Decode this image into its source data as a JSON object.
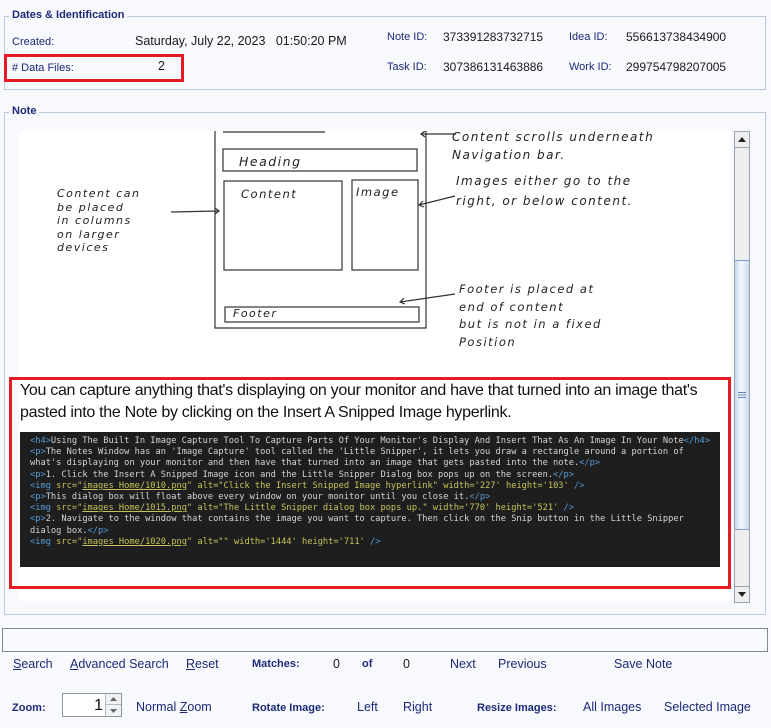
{
  "dates_section": {
    "legend": "Dates & Identification",
    "created_label": "Created:",
    "created_value": "Saturday, July 22, 2023   01:50:20 PM",
    "data_files_label": "# Data Files:",
    "data_files_value": "2",
    "note_id_label": "Note ID:",
    "note_id_value": "373391283732715",
    "idea_id_label": "Idea ID:",
    "idea_id_value": "556613738434900",
    "task_id_label": "Task ID:",
    "task_id_value": "307386131463886",
    "work_id_label": "Work ID:",
    "work_id_value": "299754798207005"
  },
  "note_section": {
    "legend": "Note",
    "sketch": {
      "box_heading": "Heading",
      "box_content": "Content",
      "box_image": "Image",
      "box_footer": "Footer",
      "annot_left": [
        "Content can",
        "be placed",
        "in columns",
        "on larger",
        "devices"
      ],
      "annot_top": [
        "Content scrolls underneath",
        "Navigation bar."
      ],
      "annot_image": [
        "Images either go to the",
        "right, or below content."
      ],
      "annot_footer": [
        "Footer is placed at",
        "end of content",
        "but is not in a fixed",
        "Position"
      ]
    },
    "description": "You can capture anything that's displaying on your monitor and have that turned into an image that's pasted into the Note by clicking on the Insert A Snipped Image hyperlink.",
    "code": {
      "h4_text": "Using The Built In Image Capture Tool To Capture Parts Of Your Monitor's Display And Insert That As An Image In Your Note",
      "p1_line1": "The Notes Window has an 'Image Capture' tool called the 'Little Snipper', it lets you draw a rectangle around a portion of",
      "p1_line2": "what's displaying on your monitor and then have that turned into an image that gets pasted into the note.",
      "p2": "1. Click the Insert A Snipped Image icon and the Little Snipper Dialog box pops up on the screen.",
      "img1_src": "images_Home/1010.png",
      "img1_alt": "Click the Insert Snipped Image hyperlink",
      "img1_width": "'227'",
      "img1_height": "'103'",
      "p3": "This dialog box will float above every window on your monitor until you close it.",
      "img2_src": "images_Home/1015.png",
      "img2_alt": "The Little Snipper dialog box pops up.",
      "img2_width": "'770'",
      "img2_height": "'521'",
      "p4_line1": "2. Navigate to the window that contains the image you want to capture. Then click on the Snip button in the Little Snipper",
      "p4_line2": "dialog box.",
      "img3_src": "images_Home/1020.png",
      "img3_alt": "",
      "img3_width": "'1444'",
      "img3_height": "'711'"
    },
    "scroll_position_fraction": 0.45
  },
  "search_bar": {
    "input_value": "",
    "search_label": "Search",
    "advanced_search_label": "Advanced Search",
    "reset_label": "Reset",
    "matches_label": "Matches:",
    "matches_current": "0",
    "of_label": "of",
    "matches_total": "0",
    "next_label": "Next",
    "previous_label": "Previous",
    "save_note_label": "Save Note"
  },
  "image_toolbar": {
    "zoom_label": "Zoom:",
    "zoom_value": "1",
    "normal_zoom_label": "Normal Zoom",
    "rotate_label": "Rotate Image:",
    "rotate_left": "Left",
    "rotate_right": "Right",
    "resize_label": "Resize Images:",
    "resize_all": "All Images",
    "resize_selected": "Selected Image"
  },
  "colors": {
    "highlight_border": "#e31b23",
    "label_navy": "#1c2a78",
    "code_bg": "#1e1e1e"
  }
}
